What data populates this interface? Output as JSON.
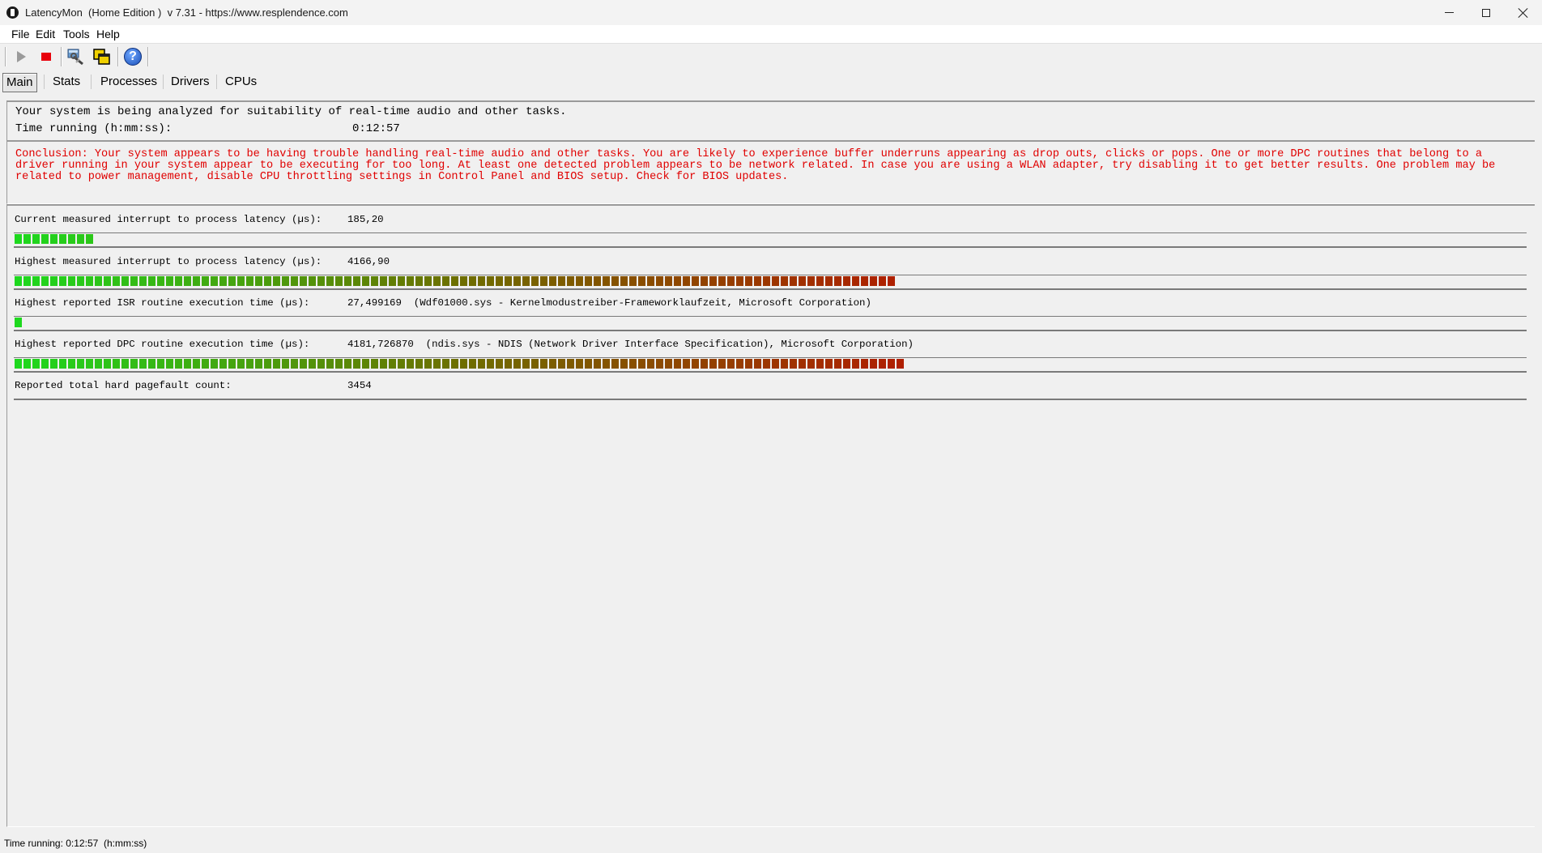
{
  "window": {
    "title": "LatencyMon  (Home Edition )  v 7.31 - https://www.resplendence.com",
    "app_icon": "latencymon-icon"
  },
  "menu": [
    "File",
    "Edit",
    "Tools",
    "Help"
  ],
  "toolbar": {
    "buttons": [
      "play-icon",
      "stop-icon",
      "wrench-icon",
      "windows-icon",
      "help-icon"
    ]
  },
  "tabs": [
    "Main",
    "Stats",
    "Processes",
    "Drivers",
    "CPUs"
  ],
  "status": {
    "analyzing": "Your system is being analyzed for suitability of real-time audio and other tasks.",
    "time_label": "Time running (h:mm:ss):",
    "time_value": "0:12:57"
  },
  "conclusion": "Conclusion: Your system appears to be having trouble handling real-time audio and other tasks. You are likely to experience buffer underruns appearing as drop outs, clicks or pops. One or more DPC routines that belong to a driver running in your system appear to be executing for too long. At least one detected problem appears to be network related. In case you are using a WLAN adapter, try disabling it to get better results. One problem may be related to power management, disable CPU throttling settings in Control Panel and BIOS setup. Check for BIOS updates.",
  "metrics": [
    {
      "label": "Current measured interrupt to process latency (µs):",
      "value": "185,20",
      "bar_level": 0.055,
      "has_bar": true
    },
    {
      "label": "Highest measured interrupt to process latency (µs):",
      "value": "4166,90",
      "bar_level": 0.584,
      "has_bar": true
    },
    {
      "label": "Highest reported ISR routine execution time (µs):",
      "value": "27,499169  (Wdf01000.sys - Kernelmodustreiber-Frameworklaufzeit, Microsoft Corporation)",
      "bar_level": 0.006,
      "has_bar": true
    },
    {
      "label": "Highest reported DPC routine execution time (µs):",
      "value": "4181,726870  (ndis.sys - NDIS (Network Driver Interface Specification), Microsoft Corporation)",
      "bar_level": 0.59,
      "has_bar": true
    },
    {
      "label": "Reported total hard pagefault count:",
      "value": "3454",
      "bar_level": 0,
      "has_bar": false
    }
  ],
  "colors": {
    "bar_low": "#1ed81e",
    "bar_mid": "#6e6e00",
    "bar_high": "#b01e00",
    "conclusion_text": "#e00000"
  },
  "statusbar": "Time running: 0:12:57  (h:mm:ss)"
}
